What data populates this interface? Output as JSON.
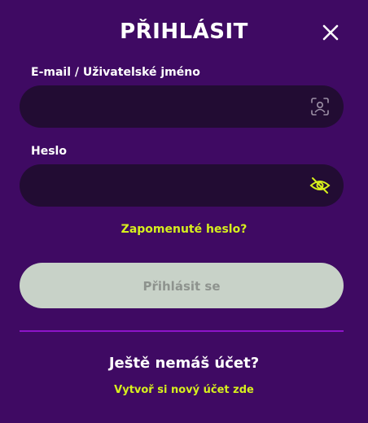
{
  "modal": {
    "title": "PŘIHLÁSIT",
    "close_icon": "close-icon"
  },
  "username": {
    "label": "E-mail / Uživatelské jméno",
    "value": "",
    "placeholder": "",
    "icon": "user-id-icon"
  },
  "password": {
    "label": "Heslo",
    "value": "",
    "placeholder": "",
    "icon": "eye-off-icon"
  },
  "forgot_password": "Zapomenuté heslo?",
  "login_button": "Přihlásit se",
  "register": {
    "question": "Ještě nemáš účet?",
    "link": "Vytvoř si nový účet zde"
  },
  "colors": {
    "background": "#3f0a63",
    "input_bg": "#220c33",
    "accent": "#d7ef1d",
    "button_bg": "#c8d2c8",
    "divider": "#8d14c9"
  }
}
